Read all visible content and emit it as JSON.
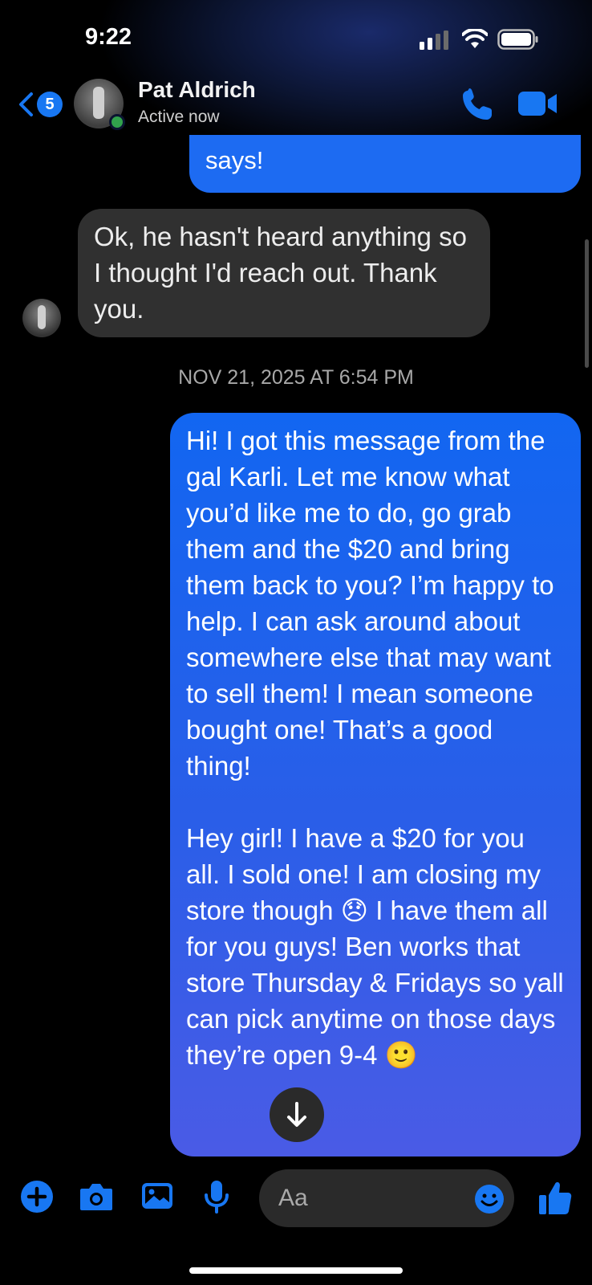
{
  "status_bar": {
    "time": "9:22"
  },
  "header": {
    "back_badge": "5",
    "contact_name": "Pat Aldrich",
    "contact_status": "Active now"
  },
  "messages": {
    "partial_outgoing": "says!",
    "incoming": "Ok, he hasn't heard anything so I thought I'd reach out. Thank you.",
    "timestamp": "NOV 21, 2025 AT 6:54 PM",
    "outgoing": "Hi! I got this message from the gal Karli. Let me know what you’d like me to do, go grab them and the $20 and bring them back to you? I’m happy to help. I can ask around about somewhere else that may want to sell them! I mean someone bought one! That’s a good thing!\n\nHey girl! I have a $20 for you all. I sold one! I am closing my store though 😞 I have them all for you guys! Ben works that store Thursday & Fridays so yall can pick anytime on those days they’re open 9-4 🙂"
  },
  "composer": {
    "placeholder": "Aa"
  },
  "colors": {
    "accent": "#1d6bf2",
    "incoming_bubble": "#303030",
    "online": "#31a24c"
  }
}
